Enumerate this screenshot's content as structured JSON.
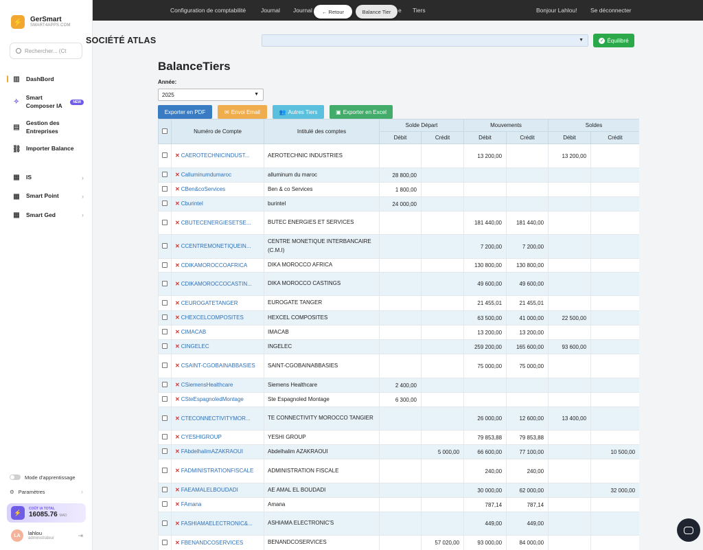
{
  "sidebar": {
    "brand_name": "GerSmart",
    "brand_sub": "SMART4APPS.COM",
    "search_placeholder": "Rechercher... (Ct",
    "items": [
      {
        "label": "DashBord",
        "icon": "dashboard-icon",
        "glyph": "▥"
      },
      {
        "label": "Smart Composer IA",
        "icon": "sparkle-icon",
        "glyph": "✧",
        "badge": "NEW"
      },
      {
        "label": "Gestion des Entreprises",
        "icon": "building-icon",
        "glyph": "▤"
      },
      {
        "label": "Importer Balance",
        "icon": "link-icon",
        "glyph": "⛓"
      },
      {
        "label": "IS",
        "icon": "grid-icon",
        "glyph": "▦"
      },
      {
        "label": "Smart Point",
        "icon": "grid-icon",
        "glyph": "▦"
      },
      {
        "label": "Smart Ged",
        "icon": "grid-icon",
        "glyph": "▦"
      }
    ],
    "mode_label": "Mode d'apprentissage",
    "param_label": "Paramètres",
    "cost_label": "COÛT IA TOTAL",
    "cost_value": "16085.76",
    "cost_unit": "MAD",
    "user_initials": "LA",
    "user_name": "lahlou",
    "user_role": "administrateur"
  },
  "topbar": {
    "link1": "Configuration de comptabilité",
    "link2": "Journal",
    "link3": "Journal",
    "link4": "e",
    "link5": "Tiers",
    "back": "← Retour",
    "current": "Balance Tier",
    "greeting": "Bonjour Lahlou!",
    "logout": "Se déconnecter"
  },
  "company": {
    "name": "SOCIÉTÉ ATLAS",
    "status": "Équilibré"
  },
  "page": {
    "title": "BalanceTiers",
    "year_label": "Année:",
    "year_value": "2025",
    "btn_pdf": "Exporter en PDF",
    "btn_mail": "Envoi Email",
    "btn_tiers": "Autres Tiers",
    "btn_excel": "Exporter en Excel"
  },
  "table": {
    "headers": {
      "account": "Numéro de Compte",
      "label": "Intitulé des comptes",
      "solde_depart": "Solde Départ",
      "mouvements": "Mouvements",
      "soldes": "Soldes",
      "debit": "Débit",
      "credit": "Crédit"
    },
    "rows": [
      {
        "account": "CAEROTECHNICINDUST...",
        "label": "AEROTECHNIC INDUSTRIES",
        "sd_d": "",
        "sd_c": "",
        "mv_d": "13 200,00",
        "mv_c": "",
        "s_d": "13 200,00",
        "s_c": "",
        "h": 35
      },
      {
        "account": "Calluminumdumaroc",
        "label": "alluminum du maroc",
        "sd_d": "28 800,00",
        "sd_c": "",
        "mv_d": "",
        "mv_c": "",
        "s_d": "",
        "s_c": "",
        "h": 21
      },
      {
        "account": "CBen&coServices",
        "label": "Ben & co Services",
        "sd_d": "1 800,00",
        "sd_c": "",
        "mv_d": "",
        "mv_c": "",
        "s_d": "",
        "s_c": "",
        "h": 21
      },
      {
        "account": "Cburintel",
        "label": "burintel",
        "sd_d": "24 000,00",
        "sd_c": "",
        "mv_d": "",
        "mv_c": "",
        "s_d": "",
        "s_c": "",
        "h": 21
      },
      {
        "account": "CBUTECENERGIESETSE...",
        "label": "BUTEC ENERGIES ET SERVICES",
        "sd_d": "",
        "sd_c": "",
        "mv_d": "181 440,00",
        "mv_c": "181 440,00",
        "s_d": "",
        "s_c": "",
        "h": 34
      },
      {
        "account": "CCENTREMONETIQUEIN...",
        "label": "CENTRE MONETIQUE INTERBANCAIRE (C.M.I)",
        "sd_d": "",
        "sd_c": "",
        "mv_d": "7 200,00",
        "mv_c": "7 200,00",
        "s_d": "",
        "s_c": "",
        "h": 35
      },
      {
        "account": "CDIKAMOROCCOAFRICA",
        "label": "DIKA MOROCCO AFRICA",
        "sd_d": "",
        "sd_c": "",
        "mv_d": "130 800,00",
        "mv_c": "130 800,00",
        "s_d": "",
        "s_c": "",
        "h": 20
      },
      {
        "account": "CDIKAMOROCCOCASTIN...",
        "label": "DIKA MOROCCO CASTINGS",
        "sd_d": "",
        "sd_c": "",
        "mv_d": "49 600,00",
        "mv_c": "49 600,00",
        "s_d": "",
        "s_c": "",
        "h": 34
      },
      {
        "account": "CEUROGATETANGER",
        "label": "EUROGATE TANGER",
        "sd_d": "",
        "sd_c": "",
        "mv_d": "21 455,01",
        "mv_c": "21 455,01",
        "s_d": "",
        "s_c": "",
        "h": 22
      },
      {
        "account": "CHEXCELCOMPOSITES",
        "label": "HEXCEL COMPOSITES",
        "sd_d": "",
        "sd_c": "",
        "mv_d": "63 500,00",
        "mv_c": "41 000,00",
        "s_d": "22 500,00",
        "s_c": "",
        "h": 21
      },
      {
        "account": "CIMACAB",
        "label": "IMACAB",
        "sd_d": "",
        "sd_c": "",
        "mv_d": "13 200,00",
        "mv_c": "13 200,00",
        "s_d": "",
        "s_c": "",
        "h": 21
      },
      {
        "account": "CINGELEC",
        "label": "INGELEC",
        "sd_d": "",
        "sd_c": "",
        "mv_d": "259 200,00",
        "mv_c": "165 600,00",
        "s_d": "93 600,00",
        "s_c": "",
        "h": 21
      },
      {
        "account": "CSAINT-CGOBAINABBASIES",
        "label": "SAINT-CGOBAINABBASIES",
        "sd_d": "",
        "sd_c": "",
        "mv_d": "75 000,00",
        "mv_c": "75 000,00",
        "s_d": "",
        "s_c": "",
        "h": 35
      },
      {
        "account": "CSiemensHealthcare",
        "label": "Siemens Healthcare",
        "sd_d": "2 400,00",
        "sd_c": "",
        "mv_d": "",
        "mv_c": "",
        "s_d": "",
        "s_c": "",
        "h": 21
      },
      {
        "account": "CSteEspagnoledMontage",
        "label": "Ste Espagnoled Montage",
        "sd_d": "6 300,00",
        "sd_c": "",
        "mv_d": "",
        "mv_c": "",
        "s_d": "",
        "s_c": "",
        "h": 21
      },
      {
        "account": "CTECONNECTIVITYMOR...",
        "label": "TE CONNECTIVITY MOROCCO TANGIER",
        "sd_d": "",
        "sd_c": "",
        "mv_d": "26 000,00",
        "mv_c": "12 600,00",
        "s_d": "13 400,00",
        "s_c": "",
        "h": 34
      },
      {
        "account": "CYESHIGROUP",
        "label": "YESHI GROUP",
        "sd_d": "",
        "sd_c": "",
        "mv_d": "79 853,88",
        "mv_c": "79 853,88",
        "s_d": "",
        "s_c": "",
        "h": 21
      },
      {
        "account": "FAbdelhalimAZAKRAOUI",
        "label": "Abdelhalim AZAKRAOUI",
        "sd_d": "",
        "sd_c": "5 000,00",
        "mv_d": "66 600,00",
        "mv_c": "77 100,00",
        "s_d": "",
        "s_c": "10 500,00",
        "h": 21
      },
      {
        "account": "FADMINISTRATIONFISCALE",
        "label": "ADMINISTRATION FISCALE",
        "sd_d": "",
        "sd_c": "",
        "mv_d": "240,00",
        "mv_c": "240,00",
        "s_d": "",
        "s_c": "",
        "h": 35
      },
      {
        "account": "FAEAMALELBOUDADI",
        "label": "AE AMAL EL BOUDADI",
        "sd_d": "",
        "sd_c": "",
        "mv_d": "30 000,00",
        "mv_c": "62 000,00",
        "s_d": "",
        "s_c": "32 000,00",
        "h": 21
      },
      {
        "account": "FAmana",
        "label": "Amana",
        "sd_d": "",
        "sd_c": "",
        "mv_d": "787,14",
        "mv_c": "787,14",
        "s_d": "",
        "s_c": "",
        "h": 21
      },
      {
        "account": "FASHIAMAELECTRONIC&...",
        "label": "ASHIAMA ELECTRONIC'S",
        "sd_d": "",
        "sd_c": "",
        "mv_d": "449,00",
        "mv_c": "449,00",
        "s_d": "",
        "s_c": "",
        "h": 34
      },
      {
        "account": "FBENANDCOSERVICES",
        "label": "BENANDCOSERVICES",
        "sd_d": "",
        "sd_c": "57 020,00",
        "mv_d": "93 000,00",
        "mv_c": "84 000,00",
        "s_d": "",
        "s_c": "",
        "h": 22
      }
    ]
  }
}
